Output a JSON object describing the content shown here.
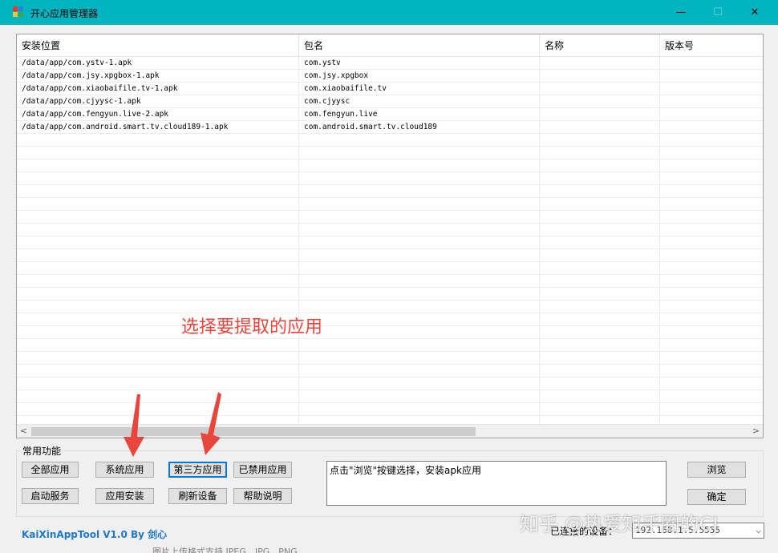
{
  "window": {
    "title": "开心应用管理器"
  },
  "title_controls": {
    "minimize": "—",
    "maximize": "☐",
    "close": "✕"
  },
  "list": {
    "columns": [
      "安装位置",
      "包名",
      "名称",
      "版本号"
    ],
    "rows": [
      [
        "/data/app/com.ystv-1.apk",
        "com.ystv",
        "",
        ""
      ],
      [
        "/data/app/com.jsy.xpgbox-1.apk",
        "com.jsy.xpgbox",
        "",
        ""
      ],
      [
        "/data/app/com.xiaobaifile.tv-1.apk",
        "com.xiaobaifile.tv",
        "",
        ""
      ],
      [
        "/data/app/com.cjyysc-1.apk",
        "com.cjyysc",
        "",
        ""
      ],
      [
        "/data/app/com.fengyun.live-2.apk",
        "com.fengyun.live",
        "",
        ""
      ],
      [
        "/data/app/com.android.smart.tv.cloud189-1.apk",
        "com.android.smart.tv.cloud189",
        "",
        ""
      ]
    ],
    "scroll_left": "<",
    "scroll_right": ">"
  },
  "group": {
    "label": "常用功能",
    "buttons": {
      "all_apps": "全部应用",
      "system_apps": "系统应用",
      "third_party_apps": "第三方应用",
      "disabled_apps": "已禁用应用",
      "start_service": "启动服务",
      "install_app": "应用安装",
      "refresh_devices": "刷新设备",
      "help": "帮助说明"
    },
    "info_text": "点击\"浏览\"按键选择，安装apk应用",
    "browse": "浏览",
    "confirm": "确定"
  },
  "status": {
    "brand": "KaiXinAppTool V1.0 By 剑心",
    "device_label": "已连接的设备：",
    "device_value": "192.168.1.5:5555"
  },
  "annotation": {
    "text": "选择要提取的应用",
    "color": "#e8453c"
  },
  "watermark": "知乎 @热爱知乎圈的CJ",
  "below_window_text": "图片上传格式支持 JPEG、JPG、PNG",
  "colors": {
    "titlebar": "#00b4c0",
    "accent": "#0078d7",
    "brand": "#1f78c8"
  }
}
